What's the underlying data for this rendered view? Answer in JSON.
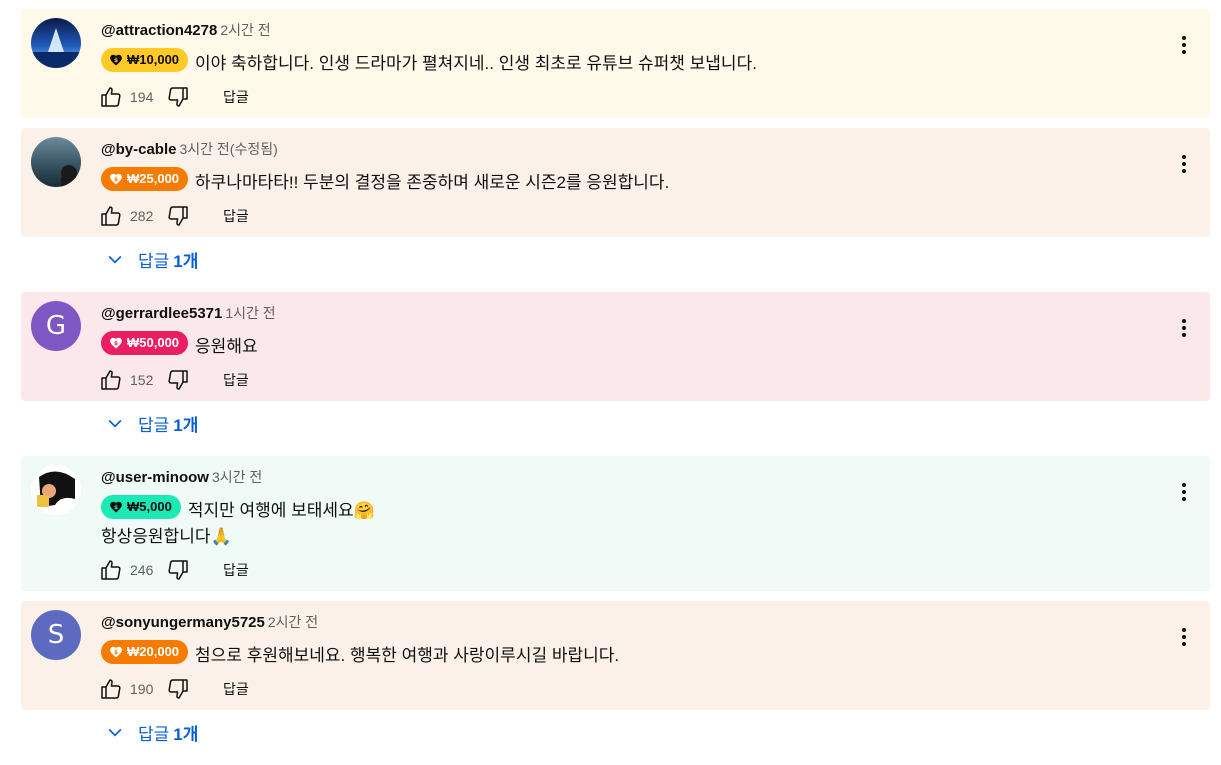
{
  "comments": [
    {
      "author": "@attraction4278",
      "time": "2시간 전",
      "amount": "₩10,000",
      "text": "이야 축하합니다. 인생 드라마가 펼쳐지네.. 인생 최초로 유튜브 슈퍼챗 보냅니다.",
      "text2": "",
      "likes": "194",
      "reply": "답글",
      "avatar_letter": "",
      "bg": "#fef9e9",
      "chip_bg": "#ffca28",
      "chip_fg": "#0f0f0f"
    },
    {
      "author": "@by-cable",
      "time": "3시간 전(수정됨)",
      "amount": "₩25,000",
      "text": "하쿠나마타타!! 두분의 결정을 존중하며 새로운 시즌2를 응원합니다.",
      "text2": "",
      "likes": "282",
      "reply": "답글",
      "avatar_letter": "",
      "bg": "#fcf1e8",
      "chip_bg": "#f57c00",
      "chip_fg": "#ffffff",
      "replies_label": "답글",
      "replies_count": "1개"
    },
    {
      "author": "@gerrardlee5371",
      "time": "1시간 전",
      "amount": "₩50,000",
      "text": "응원해요",
      "text2": "",
      "likes": "152",
      "reply": "답글",
      "avatar_letter": "G",
      "bg": "#fbe8eb",
      "chip_bg": "#e91e63",
      "chip_fg": "#ffffff",
      "replies_label": "답글",
      "replies_count": "1개"
    },
    {
      "author": "@user-minoow",
      "time": "3시간 전",
      "amount": "₩5,000",
      "text": "적지만 여행에 보태세요🤗",
      "text2": "항상응원합니다🙏",
      "likes": "246",
      "reply": "답글",
      "avatar_letter": "",
      "bg": "#f0fbf7",
      "chip_bg": "#1de9b6",
      "chip_fg": "#0f0f0f"
    },
    {
      "author": "@sonyungermany5725",
      "time": "2시간 전",
      "amount": "₩20,000",
      "text": "첨으로 후원해보네요. 행복한 여행과 사랑이루시길 바랍니다.",
      "text2": "",
      "likes": "190",
      "reply": "답글",
      "avatar_letter": "S",
      "bg": "#fcf1e8",
      "chip_bg": "#f57c00",
      "chip_fg": "#ffffff",
      "replies_label": "답글",
      "replies_count": "1개"
    }
  ],
  "icons": {
    "like": "thumb-up-icon",
    "dislike": "thumb-down-icon",
    "menu": "more-vert-icon",
    "chevron": "chevron-down-icon",
    "superchat": "superchat-heart-icon"
  }
}
